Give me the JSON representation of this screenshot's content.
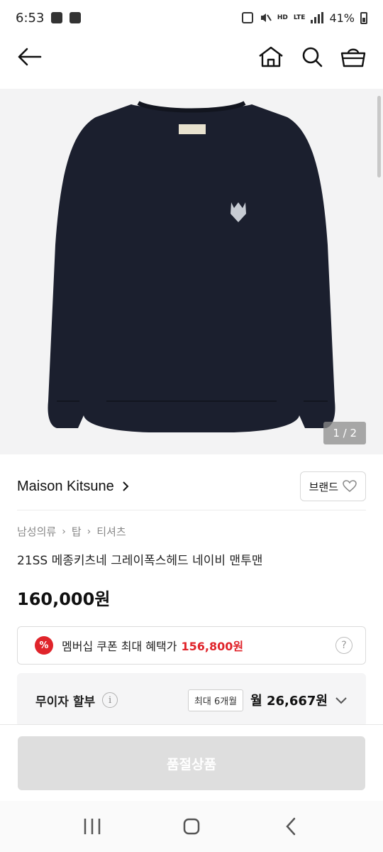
{
  "status_bar": {
    "time": "6:53",
    "hd_label": "HD",
    "lte_label": "LTE",
    "battery_percent": "41%"
  },
  "icons": {
    "back": "back-arrow-icon",
    "home": "home-icon",
    "search": "search-icon",
    "cart": "cart-icon"
  },
  "product": {
    "image_counter": "1 / 2",
    "brand": "Maison Kitsune",
    "brand_like_label": "브랜드",
    "breadcrumb": [
      "남성의류",
      "탑",
      "티셔츠"
    ],
    "title": "21SS 메종키츠네 그레이폭스헤드 네이비 맨투맨",
    "price": "160,000원"
  },
  "coupon": {
    "badge": "%",
    "label": "멤버십 쿠폰 최대 혜택가",
    "amount": "156,800원",
    "help": "?"
  },
  "installment": {
    "label": "무이자 할부",
    "info": "i",
    "tag": "최대 6개월",
    "amount": "월 26,667원"
  },
  "bottom": {
    "soldout_label": "품절상품"
  },
  "colors": {
    "accent_red": "#e0242b",
    "sweatshirt_navy": "#1b1f2e",
    "image_bg": "#f3f3f4"
  }
}
